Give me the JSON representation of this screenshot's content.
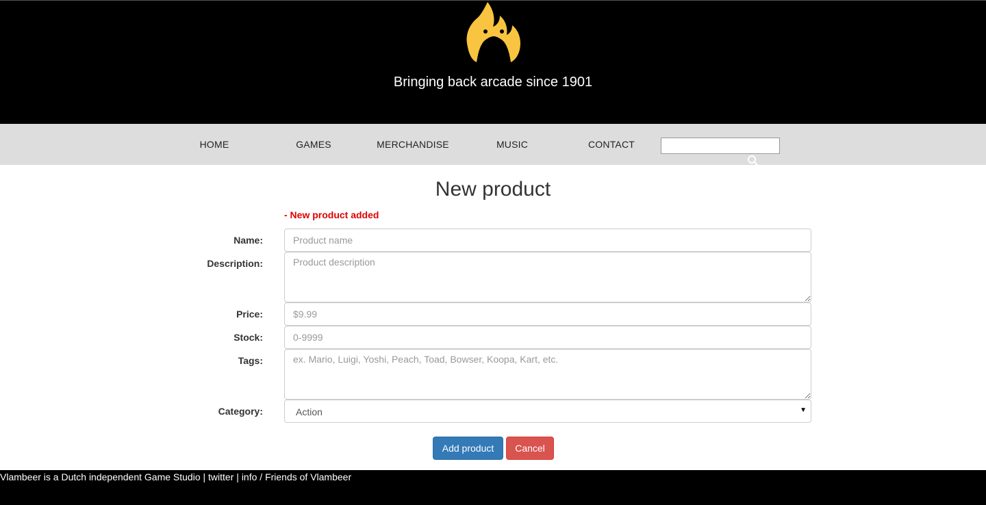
{
  "header": {
    "tagline": "Bringing back arcade since 1901",
    "logo_icon": "flame-logo-icon",
    "logo_color": "#f9c43f"
  },
  "nav": {
    "items": [
      "HOME",
      "GAMES",
      "MERCHANDISE",
      "MUSIC",
      "CONTACT"
    ],
    "search_value": "",
    "search_icon": "search-icon"
  },
  "main": {
    "title": "New product",
    "flash": "- New product added",
    "form": {
      "name_label": "Name:",
      "name_placeholder": "Product name",
      "description_label": "Description:",
      "description_placeholder": "Product description",
      "price_label": "Price:",
      "price_placeholder": "$9.99",
      "stock_label": "Stock:",
      "stock_placeholder": "0-9999",
      "tags_label": "Tags:",
      "tags_placeholder": "ex. Mario, Luigi, Yoshi, Peach, Toad, Bowser, Koopa, Kart, etc.",
      "category_label": "Category:",
      "category_value": "Action",
      "add_button": "Add product",
      "cancel_button": "Cancel"
    }
  },
  "footer": {
    "prefix": "Vlambeer is a Dutch independent Game Studio | ",
    "twitter": "twitter",
    "sep": " | ",
    "info": "info",
    "slash": " / ",
    "friends": "Friends of Vlambeer"
  },
  "colors": {
    "primary": "#337ab7",
    "danger": "#d9534f",
    "flash": "#e00000"
  }
}
